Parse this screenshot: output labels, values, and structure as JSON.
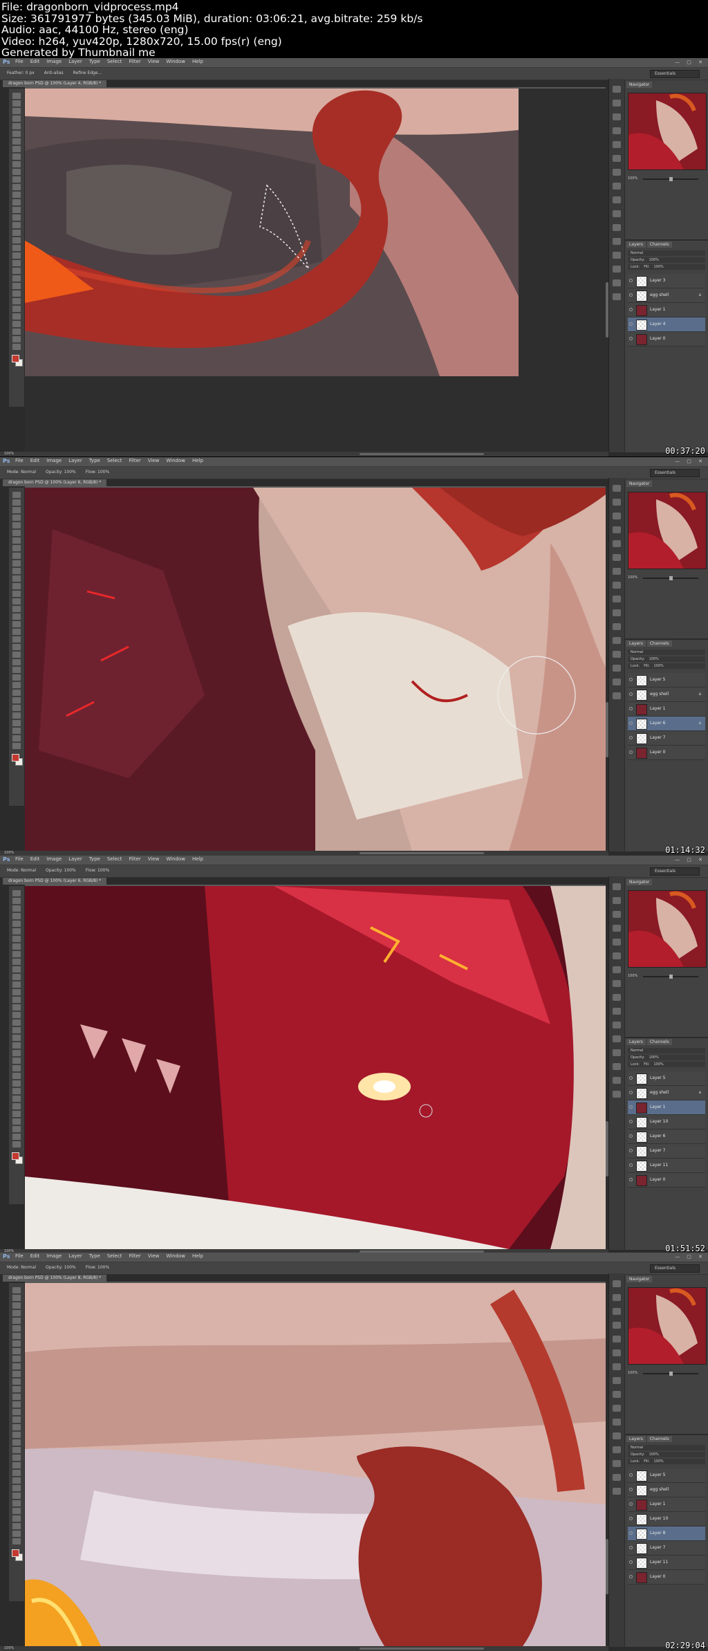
{
  "header": {
    "lines": [
      "File: dragonborn_vidprocess.mp4",
      "Size: 361791977 bytes (345.03 MiB), duration: 03:06:21, avg.bitrate: 259 kb/s",
      "Audio: aac, 44100 Hz, stereo (eng)",
      "Video: h264, yuv420p, 1280x720, 15.00 fps(r) (eng)",
      "Generated by Thumbnail me"
    ]
  },
  "app": {
    "logo": "Ps",
    "menus": [
      "File",
      "Edit",
      "Image",
      "Layer",
      "Type",
      "Select",
      "Filter",
      "View",
      "Window",
      "Help"
    ],
    "workspace": "Essentials",
    "navigator_tab": "Navigator",
    "layers_tabs": [
      "Layers",
      "Channels"
    ],
    "blend_mode": "Normal",
    "opacity_label": "Opacity:",
    "opacity_value": "100%",
    "fill_label": "Fill:",
    "fill_value": "100%",
    "lock_label": "Lock:",
    "zoom_value": "100%"
  },
  "frames": [
    {
      "timestamp": "00:37:20",
      "doc_tab": "dragon born PSD @ 100% (Layer 4, RGB/8) *",
      "options": [
        "Feather: 0 px",
        "Anti-alias",
        "Refine Edge..."
      ],
      "layers": [
        {
          "name": "Layer 3",
          "thumb": "checker",
          "selected": false
        },
        {
          "name": "egg shell",
          "thumb": "checker",
          "selected": false,
          "lock": "a"
        },
        {
          "name": "Layer 1",
          "thumb": "red",
          "selected": false
        },
        {
          "name": "Layer 4",
          "thumb": "checker",
          "selected": true
        },
        {
          "name": "Layer 0",
          "thumb": "red",
          "selected": false
        }
      ]
    },
    {
      "timestamp": "01:14:32",
      "doc_tab": "dragon born PSD @ 100% (Layer 6, RGB/8) *",
      "options": [
        "Mode: Normal",
        "Opacity: 100%",
        "Flow: 100%"
      ],
      "layers": [
        {
          "name": "Layer 5",
          "thumb": "checker",
          "selected": false
        },
        {
          "name": "egg shell",
          "thumb": "checker",
          "selected": false,
          "lock": "a"
        },
        {
          "name": "Layer 1",
          "thumb": "red",
          "selected": false
        },
        {
          "name": "Layer 6",
          "thumb": "checker",
          "selected": true,
          "lock": "a"
        },
        {
          "name": "Layer 7",
          "thumb": "checker",
          "selected": false
        },
        {
          "name": "Layer 0",
          "thumb": "red",
          "selected": false
        }
      ]
    },
    {
      "timestamp": "01:51:52",
      "doc_tab": "dragon born PSD @ 100% (Layer 6, RGB/8) *",
      "options": [
        "Mode: Normal",
        "Opacity: 100%",
        "Flow: 100%"
      ],
      "layers": [
        {
          "name": "Layer 5",
          "thumb": "checker",
          "selected": false
        },
        {
          "name": "egg shell",
          "thumb": "checker",
          "selected": false,
          "lock": "a"
        },
        {
          "name": "Layer 1",
          "thumb": "red",
          "selected": true
        },
        {
          "name": "Layer 10",
          "thumb": "checker",
          "selected": false
        },
        {
          "name": "Layer 6",
          "thumb": "checker",
          "selected": false
        },
        {
          "name": "Layer 7",
          "thumb": "checker",
          "selected": false
        },
        {
          "name": "Layer 11",
          "thumb": "checker",
          "selected": false
        },
        {
          "name": "Layer 0",
          "thumb": "red",
          "selected": false
        }
      ]
    },
    {
      "timestamp": "02:29:04",
      "doc_tab": "dragon born PSD @ 100% (Layer 8, RGB/8) *",
      "options": [
        "Mode: Normal",
        "Opacity: 100%",
        "Flow: 100%"
      ],
      "layers": [
        {
          "name": "Layer 5",
          "thumb": "checker",
          "selected": false
        },
        {
          "name": "egg shell",
          "thumb": "checker",
          "selected": false
        },
        {
          "name": "Layer 1",
          "thumb": "red",
          "selected": false
        },
        {
          "name": "Layer 10",
          "thumb": "checker",
          "selected": false
        },
        {
          "name": "Layer 8",
          "thumb": "checker",
          "selected": true
        },
        {
          "name": "Layer 7",
          "thumb": "checker",
          "selected": false
        },
        {
          "name": "Layer 11",
          "thumb": "checker",
          "selected": false
        },
        {
          "name": "Layer 0",
          "thumb": "red",
          "selected": false
        }
      ]
    }
  ],
  "colors": {
    "accent_selection": "#5a6e8c",
    "ui_dark": "#2b2b2b",
    "ui_panel": "#424242",
    "flesh": "#d8a89a",
    "dragon_red": "#a8182a"
  }
}
